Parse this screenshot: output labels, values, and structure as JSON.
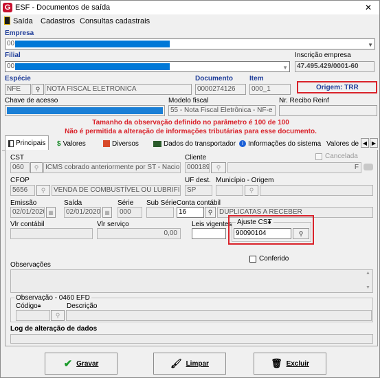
{
  "window": {
    "title": "ESF - Documentos de saída",
    "close_glyph": "✕"
  },
  "menu": {
    "items": [
      "Saída",
      "Cadastros",
      "Consultas cadastrais"
    ]
  },
  "empresa": {
    "label": "Empresa",
    "value": "001"
  },
  "filial": {
    "label": "Filial",
    "value": "001"
  },
  "inscricao": {
    "label": "Inscrição empresa",
    "value": "47.495.429/0001-60"
  },
  "especie": {
    "label": "Espécie",
    "code": "NFE",
    "desc": "NOTA FISCAL ELETRONICA"
  },
  "documento": {
    "label": "Documento",
    "value": "0000274126"
  },
  "item": {
    "label": "Item",
    "value": "000_1"
  },
  "origem": {
    "text": "Origem: TRR"
  },
  "chave": {
    "label": "Chave de acesso"
  },
  "modelo": {
    "label": "Modelo fiscal",
    "value": "55 - Nota Fiscal Eletrônica - NF-e"
  },
  "recibo": {
    "label": "Nr. Recibo Reinf"
  },
  "warnings": {
    "line1": "Tamanho da observação definido no parâmetro é 100 de 100",
    "line2": "Não é permitida a alteração de informações tributárias para esse documento."
  },
  "tabs": [
    {
      "label": "Principais"
    },
    {
      "label": "Valores"
    },
    {
      "label": "Diversos"
    },
    {
      "label": "Dados do transportador"
    },
    {
      "label": "Informações do sistema"
    },
    {
      "label": "Valores de"
    }
  ],
  "cst": {
    "label": "CST",
    "code": "060",
    "desc": "ICMS cobrado anteriormente por ST - Nacional"
  },
  "cliente": {
    "label": "Cliente",
    "code": "000189",
    "suffix": "F"
  },
  "cancelada": {
    "label": "Cancelada"
  },
  "cfop": {
    "label": "CFOP",
    "code": "5656",
    "desc": "VENDA DE COMBUSTÍVEL OU LUBRIFICAN"
  },
  "uf": {
    "label": "UF dest.",
    "value": "SP"
  },
  "municipio": {
    "label": "Município - Origem"
  },
  "emissao": {
    "label": "Emissão",
    "value": "02/01/2020"
  },
  "saida": {
    "label": "Saída",
    "value": "02/01/2020"
  },
  "serie": {
    "label": "Série",
    "value": "000"
  },
  "subserie": {
    "label": "Sub Série"
  },
  "conta": {
    "label": "Conta contábil",
    "code": "16",
    "desc": "DUPLICATAS A RECEBER"
  },
  "vlr_contabil": {
    "label": "Vlr contábil"
  },
  "vlr_servico": {
    "label": "Vlr serviço",
    "value": "0,00"
  },
  "leis": {
    "label": "Leis vigentes"
  },
  "ajuste": {
    "label": "Ajuste CST",
    "value": "90090104"
  },
  "conferido": {
    "label": "Conferido"
  },
  "observacoes": {
    "label": "Observações"
  },
  "obs0460": {
    "label": "Observação - 0460 EFD",
    "codigo": "Código",
    "descricao": "Descrição"
  },
  "log": {
    "label": "Log de alteração de dados"
  },
  "buttons": {
    "gravar": "Gravar",
    "limpar": "Limpar",
    "excluir": "Excluir"
  }
}
